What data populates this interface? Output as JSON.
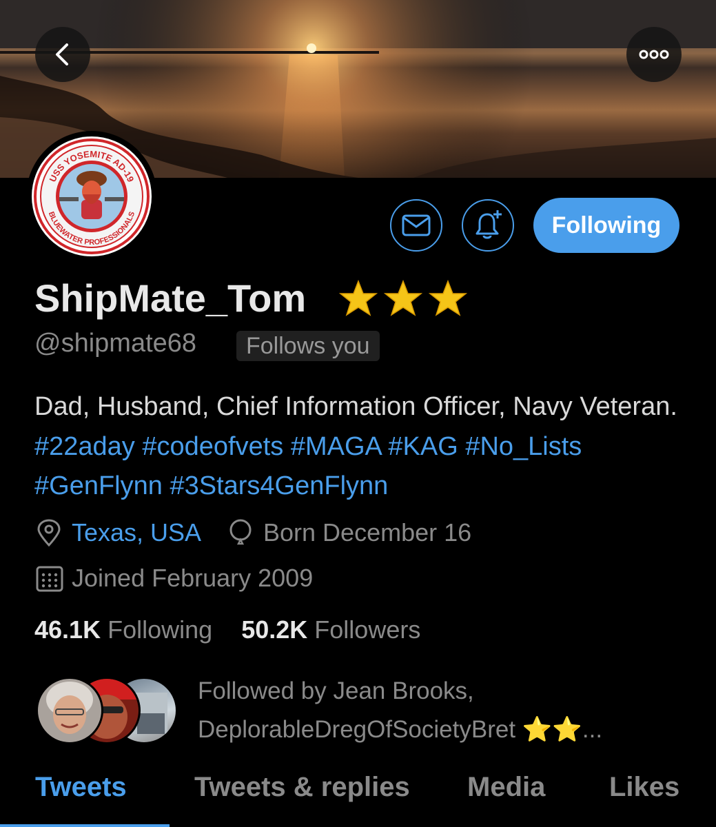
{
  "header": {
    "back_icon": "chevron-left-icon",
    "more_icon": "ellipsis-icon"
  },
  "avatar": {
    "top_text": "USS YOSEMITE AD-19",
    "bottom_text": "BLUEWATER PROFESSIONALS"
  },
  "actions": {
    "message_icon": "envelope-icon",
    "notify_icon": "bell-plus-icon",
    "follow_label": "Following"
  },
  "profile": {
    "name": "ShipMate_Tom",
    "name_badges": "⭐⭐⭐",
    "handle": "@shipmate68",
    "follows_you": "Follows you",
    "bio_text": "Dad, Husband, Chief Information Officer, Navy Veteran.",
    "bio_tags": [
      "#22aday",
      "#codeofvets",
      "#MAGA",
      "#KAG",
      "#No_Lists",
      "#GenFlynn",
      "#3Stars4GenFlynn"
    ],
    "location": "Texas, USA",
    "birthday": "Born December 16",
    "joined": "Joined February 2009"
  },
  "stats": {
    "following_count": "46.1K",
    "following_label": "Following",
    "followers_count": "50.2K",
    "followers_label": "Followers"
  },
  "followed_by": {
    "line1": "Followed by Jean Brooks,",
    "line2": "DeplorableDregOfSocietyBret ⭐⭐..."
  },
  "tabs": [
    {
      "label": "Tweets",
      "active": true
    },
    {
      "label": "Tweets & replies",
      "active": false
    },
    {
      "label": "Media",
      "active": false
    },
    {
      "label": "Likes",
      "active": false
    }
  ],
  "colors": {
    "accent": "#4a9eeb",
    "background": "#000000",
    "secondary_text": "#8a8a8a"
  }
}
